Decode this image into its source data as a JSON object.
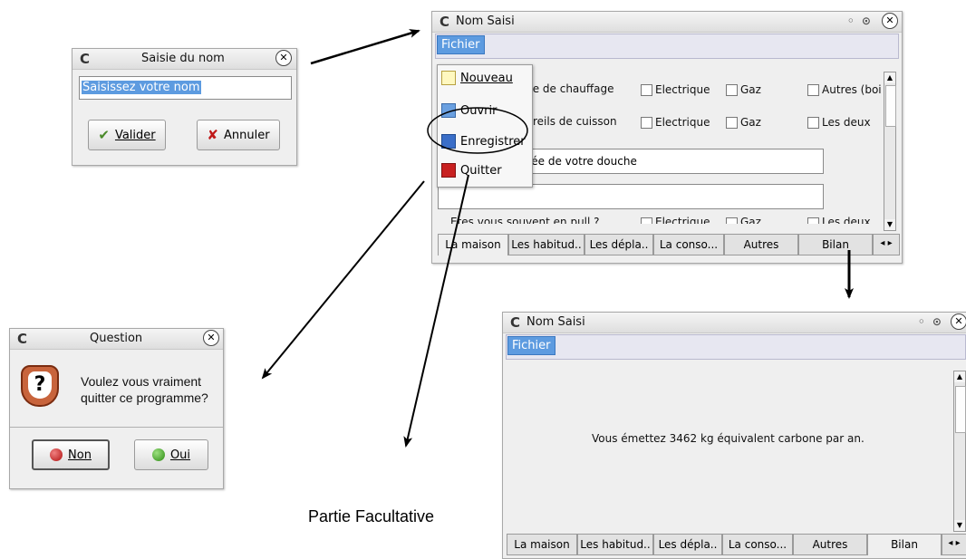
{
  "saisie": {
    "title": "Saisie du nom",
    "input_value": "Saisissez votre nom",
    "validate_label": "Valider",
    "cancel_label": "Annuler"
  },
  "main_window": {
    "title": "Nom Saisi",
    "menu_label": "Fichier",
    "menu_items": [
      {
        "label": "Nouveau",
        "icon": "new-file-icon"
      },
      {
        "label": "Ouvrir",
        "icon": "open-folder-icon"
      },
      {
        "label": "Enregistrer",
        "icon": "save-disk-icon"
      },
      {
        "label": "Quitter",
        "icon": "exit-door-icon"
      }
    ],
    "rows": [
      {
        "label": "ype de chauffage",
        "options": [
          "Electrique",
          "Gaz",
          "Autres (boi"
        ]
      },
      {
        "label": "pareils de cuisson",
        "options": [
          "Electrique",
          "Gaz",
          "Les deux"
        ]
      }
    ],
    "shower_label": "urée de votre douche",
    "partial_row": {
      "label": "Etes vous souvent en pull ?",
      "options": [
        "Electrique",
        "Gaz",
        "Les deux"
      ]
    },
    "tabs": [
      "La maison",
      "Les habitud..",
      "Les dépla..",
      "La conso...",
      "Autres",
      "Bilan"
    ]
  },
  "question": {
    "title": "Question",
    "message_line1": "Voulez vous vraiment",
    "message_line2": "quitter ce programme?",
    "no_label": "Non",
    "yes_label": "Oui"
  },
  "result_window": {
    "title": "Nom Saisi",
    "menu_label": "Fichier",
    "message": "Vous émettez  3462  kg équivalent carbone par an.",
    "tabs": [
      "La maison",
      "Les habitud..",
      "Les dépla..",
      "La conso...",
      "Autres",
      "Bilan"
    ]
  },
  "caption": "Partie Facultative",
  "colors": {
    "menu_blue": "#5d9be0",
    "arrow": "#000000"
  }
}
